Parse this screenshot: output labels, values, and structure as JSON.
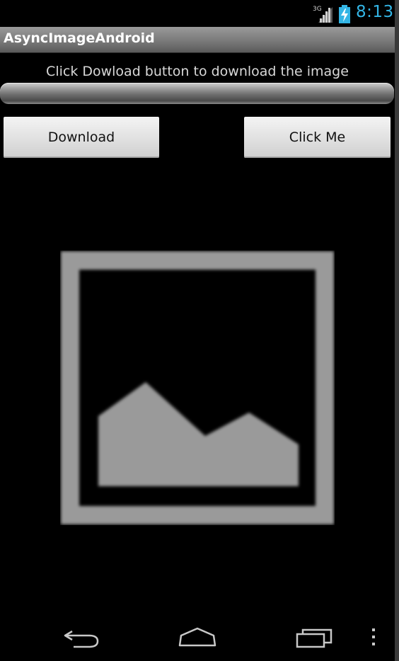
{
  "status_bar": {
    "network_label": "3G",
    "time": "8:13",
    "icons": [
      "signal-3g-icon",
      "battery-charging-icon"
    ],
    "clock_color": "#33b5e5"
  },
  "action_bar": {
    "title": "AsyncImageAndroid"
  },
  "main": {
    "instruction": "Click Dowload button to download the image",
    "download_button": "Download",
    "click_me_button": "Click Me",
    "image": "image-placeholder-icon"
  },
  "nav_bar": {
    "icons": [
      "back-icon",
      "home-icon",
      "recent-apps-icon",
      "overflow-menu-icon"
    ]
  }
}
